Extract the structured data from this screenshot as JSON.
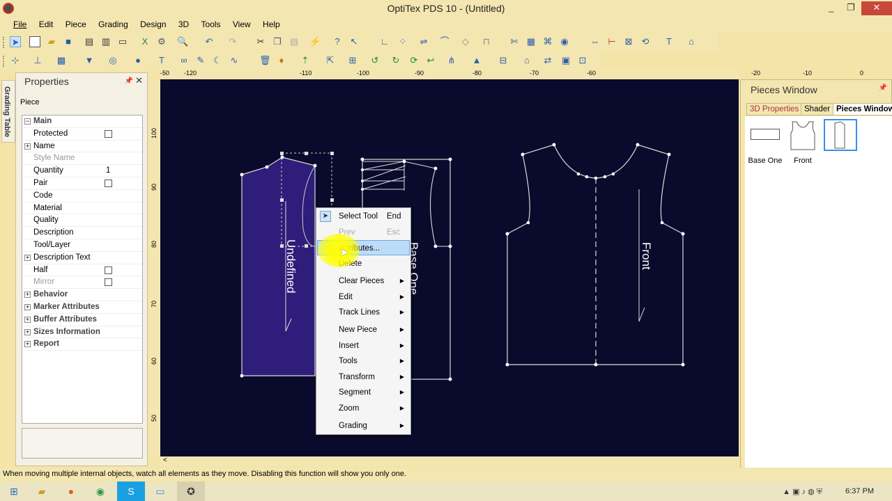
{
  "window": {
    "title": "OptiTex PDS 10 - (Untitled)",
    "minimize": "_",
    "restore": "❐",
    "close": "✕"
  },
  "menu": [
    "File",
    "Edit",
    "Piece",
    "Grading",
    "Design",
    "3D",
    "Tools",
    "View",
    "Help"
  ],
  "side_tab": "Grading Table",
  "properties": {
    "title": "Properties",
    "subtitle": "Piece",
    "rows": [
      {
        "label": "Main",
        "type": "group",
        "expand": "−"
      },
      {
        "label": "Protected",
        "type": "check"
      },
      {
        "label": "Name",
        "type": "expand",
        "expand": "+"
      },
      {
        "label": "Style Name",
        "type": "disabled"
      },
      {
        "label": "Quantity",
        "value": "1"
      },
      {
        "label": "Pair",
        "type": "check"
      },
      {
        "label": "Code"
      },
      {
        "label": "Material"
      },
      {
        "label": "Quality"
      },
      {
        "label": "Description"
      },
      {
        "label": "Tool/Layer"
      },
      {
        "label": "Description Text",
        "type": "expand",
        "expand": "+"
      },
      {
        "label": "Half",
        "type": "check"
      },
      {
        "label": "Mirror",
        "type": "check-dis"
      },
      {
        "label": "Behavior",
        "type": "group",
        "expand": "+"
      },
      {
        "label": "Marker Attributes",
        "type": "group",
        "expand": "+"
      },
      {
        "label": "Buffer Attributes",
        "type": "group",
        "expand": "+"
      },
      {
        "label": "Sizes Information",
        "type": "group",
        "expand": "+"
      },
      {
        "label": "Report",
        "type": "group",
        "expand": "+"
      }
    ]
  },
  "ruler_top": [
    "-120",
    "-110",
    "-100",
    "-90",
    "-80",
    "-70",
    "-60",
    "-50"
  ],
  "ruler_right": [
    "-20",
    "-10",
    "0"
  ],
  "ruler_left": [
    "100",
    "90",
    "80",
    "70",
    "60",
    "50"
  ],
  "canvas": {
    "label_undefined": "Undefined",
    "label_base_one": "Base One",
    "label_front": "Front"
  },
  "pieces_window": {
    "title": "Pieces Window",
    "tabs": [
      "3D Properties",
      "Shader",
      "Pieces Window"
    ],
    "items": [
      "Base One",
      "Front",
      ""
    ]
  },
  "context_menu": [
    {
      "label": "Select Tool",
      "shortcut": "End"
    },
    {
      "label": "Prev",
      "shortcut": "Esc",
      "disabled": true
    },
    {
      "label": "Attributes...",
      "highlight": true
    },
    {
      "label": "Delete"
    },
    {
      "label": "Clear Pieces",
      "sub": true
    },
    {
      "label": "Edit",
      "sub": true
    },
    {
      "label": "Track Lines",
      "sub": true
    },
    {
      "label": "New Piece",
      "sub": true
    },
    {
      "label": "Insert",
      "sub": true
    },
    {
      "label": "Tools",
      "sub": true
    },
    {
      "label": "Transform",
      "sub": true
    },
    {
      "label": "Segment",
      "sub": true
    },
    {
      "label": "Zoom",
      "sub": true
    },
    {
      "label": "Grading",
      "sub": true
    }
  ],
  "status": "When moving multiple internal objects, watch all elements as they move. Disabling this function will show you only one.",
  "taskbar": {
    "clock": "6:37 PM"
  },
  "colors": {
    "canvas": "#0a0a2c",
    "piece_fill": "#2e1d7a",
    "highlight": "#bcdcf7"
  }
}
